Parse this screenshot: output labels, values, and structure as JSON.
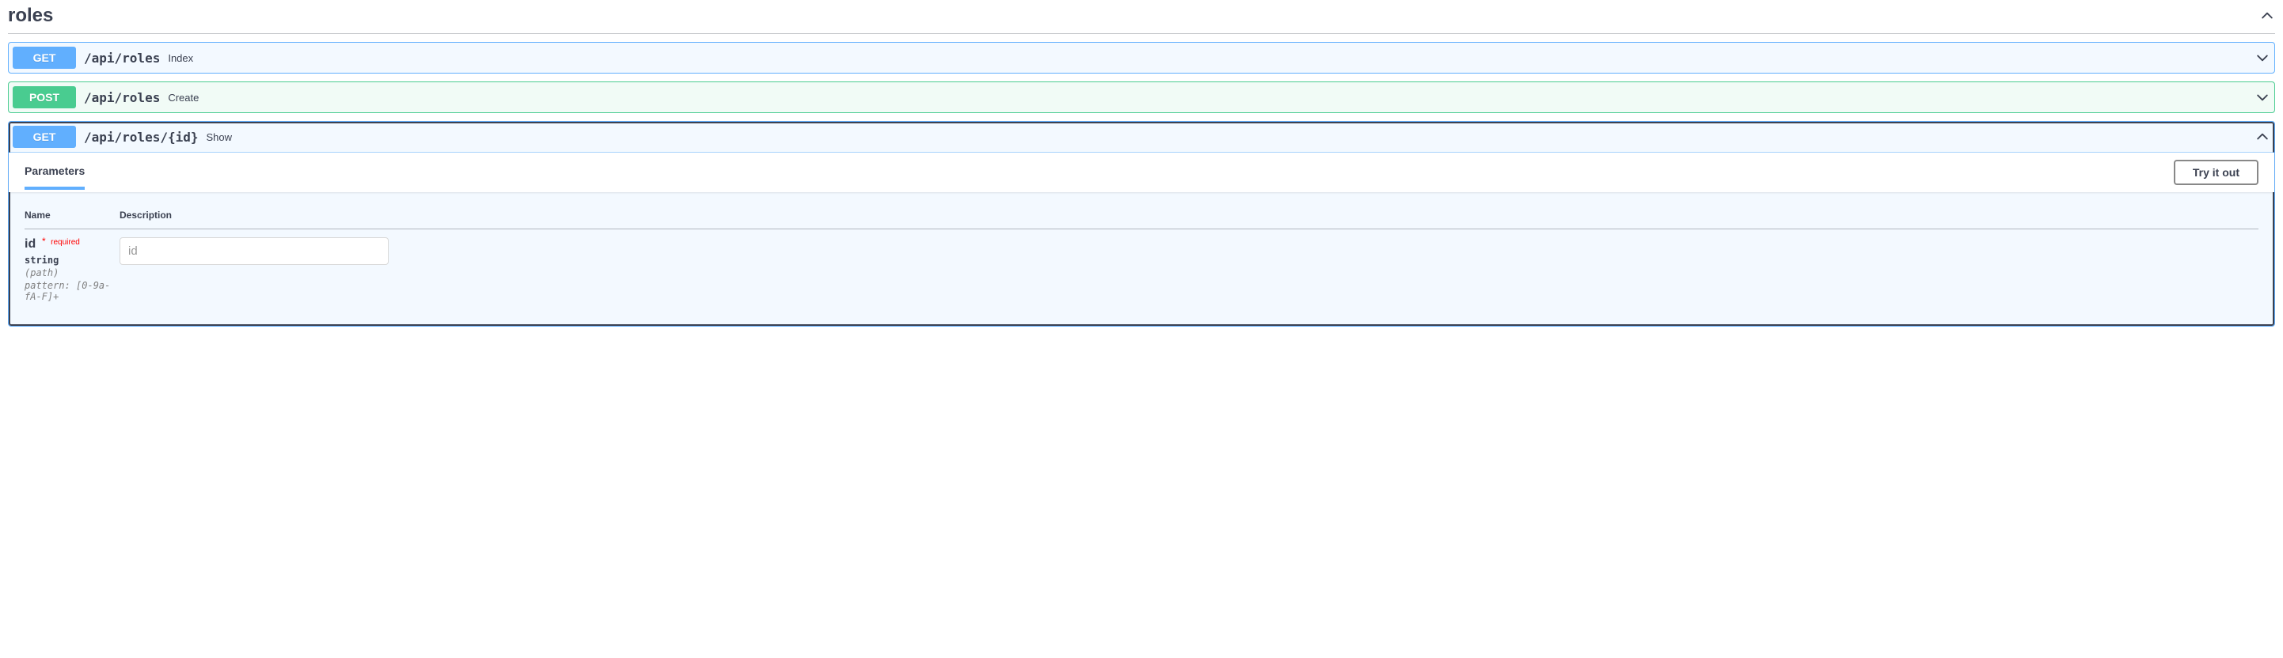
{
  "tag": {
    "name": "roles"
  },
  "endpoints": [
    {
      "method": "GET",
      "path": "/api/roles",
      "summary": "Index"
    },
    {
      "method": "POST",
      "path": "/api/roles",
      "summary": "Create"
    },
    {
      "method": "GET",
      "path": "/api/roles/{id}",
      "summary": "Show"
    }
  ],
  "parameters_section": {
    "tab_label": "Parameters",
    "try_label": "Try it out",
    "columns": {
      "name": "Name",
      "description": "Description"
    },
    "params": [
      {
        "name": "id",
        "required_label": "required",
        "type": "string",
        "in": "(path)",
        "pattern": "pattern: [0-9a-fA-F]+",
        "placeholder": "id"
      }
    ]
  }
}
